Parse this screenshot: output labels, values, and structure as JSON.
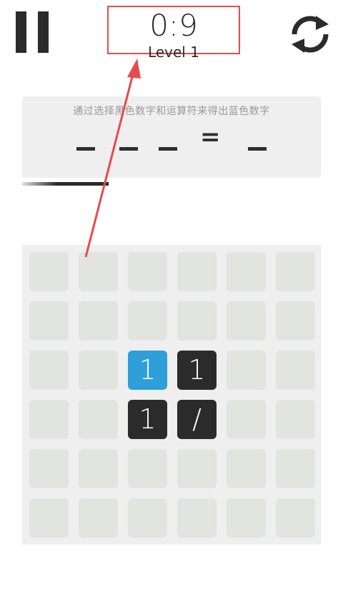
{
  "header": {
    "timer": "0:9",
    "level": "Level 1",
    "highlight_color": "#e84b4b"
  },
  "icons": {
    "pause": "pause-icon",
    "restart": "refresh-icon"
  },
  "equation": {
    "instruction": "通过选择黑色数字和运算符来得出蓝色数字",
    "operand_slots": [
      "_",
      "_",
      "_"
    ],
    "equals": "=",
    "result_slot": "_"
  },
  "progress": {
    "value": 0.29
  },
  "board": {
    "rows": 6,
    "cols": 6,
    "cells": [
      [
        "",
        "",
        "",
        "",
        "",
        ""
      ],
      [
        "",
        "",
        "",
        "",
        "",
        ""
      ],
      [
        "",
        "",
        "1",
        "1",
        "",
        ""
      ],
      [
        "",
        "",
        "1",
        "/",
        "",
        ""
      ],
      [
        "",
        "",
        "",
        "",
        "",
        ""
      ],
      [
        "",
        "",
        "",
        "",
        "",
        ""
      ]
    ],
    "styles": [
      [
        "empty",
        "empty",
        "empty",
        "empty",
        "empty",
        "empty"
      ],
      [
        "empty",
        "empty",
        "empty",
        "empty",
        "empty",
        "empty"
      ],
      [
        "empty",
        "empty",
        "blue",
        "black",
        "empty",
        "empty"
      ],
      [
        "empty",
        "empty",
        "black",
        "black",
        "empty",
        "empty"
      ],
      [
        "empty",
        "empty",
        "empty",
        "empty",
        "empty",
        "empty"
      ],
      [
        "empty",
        "empty",
        "empty",
        "empty",
        "empty",
        "empty"
      ]
    ],
    "colors": {
      "black": "#2b2b2b",
      "blue": "#2e9fd8",
      "empty": "#e2e4e0"
    }
  }
}
